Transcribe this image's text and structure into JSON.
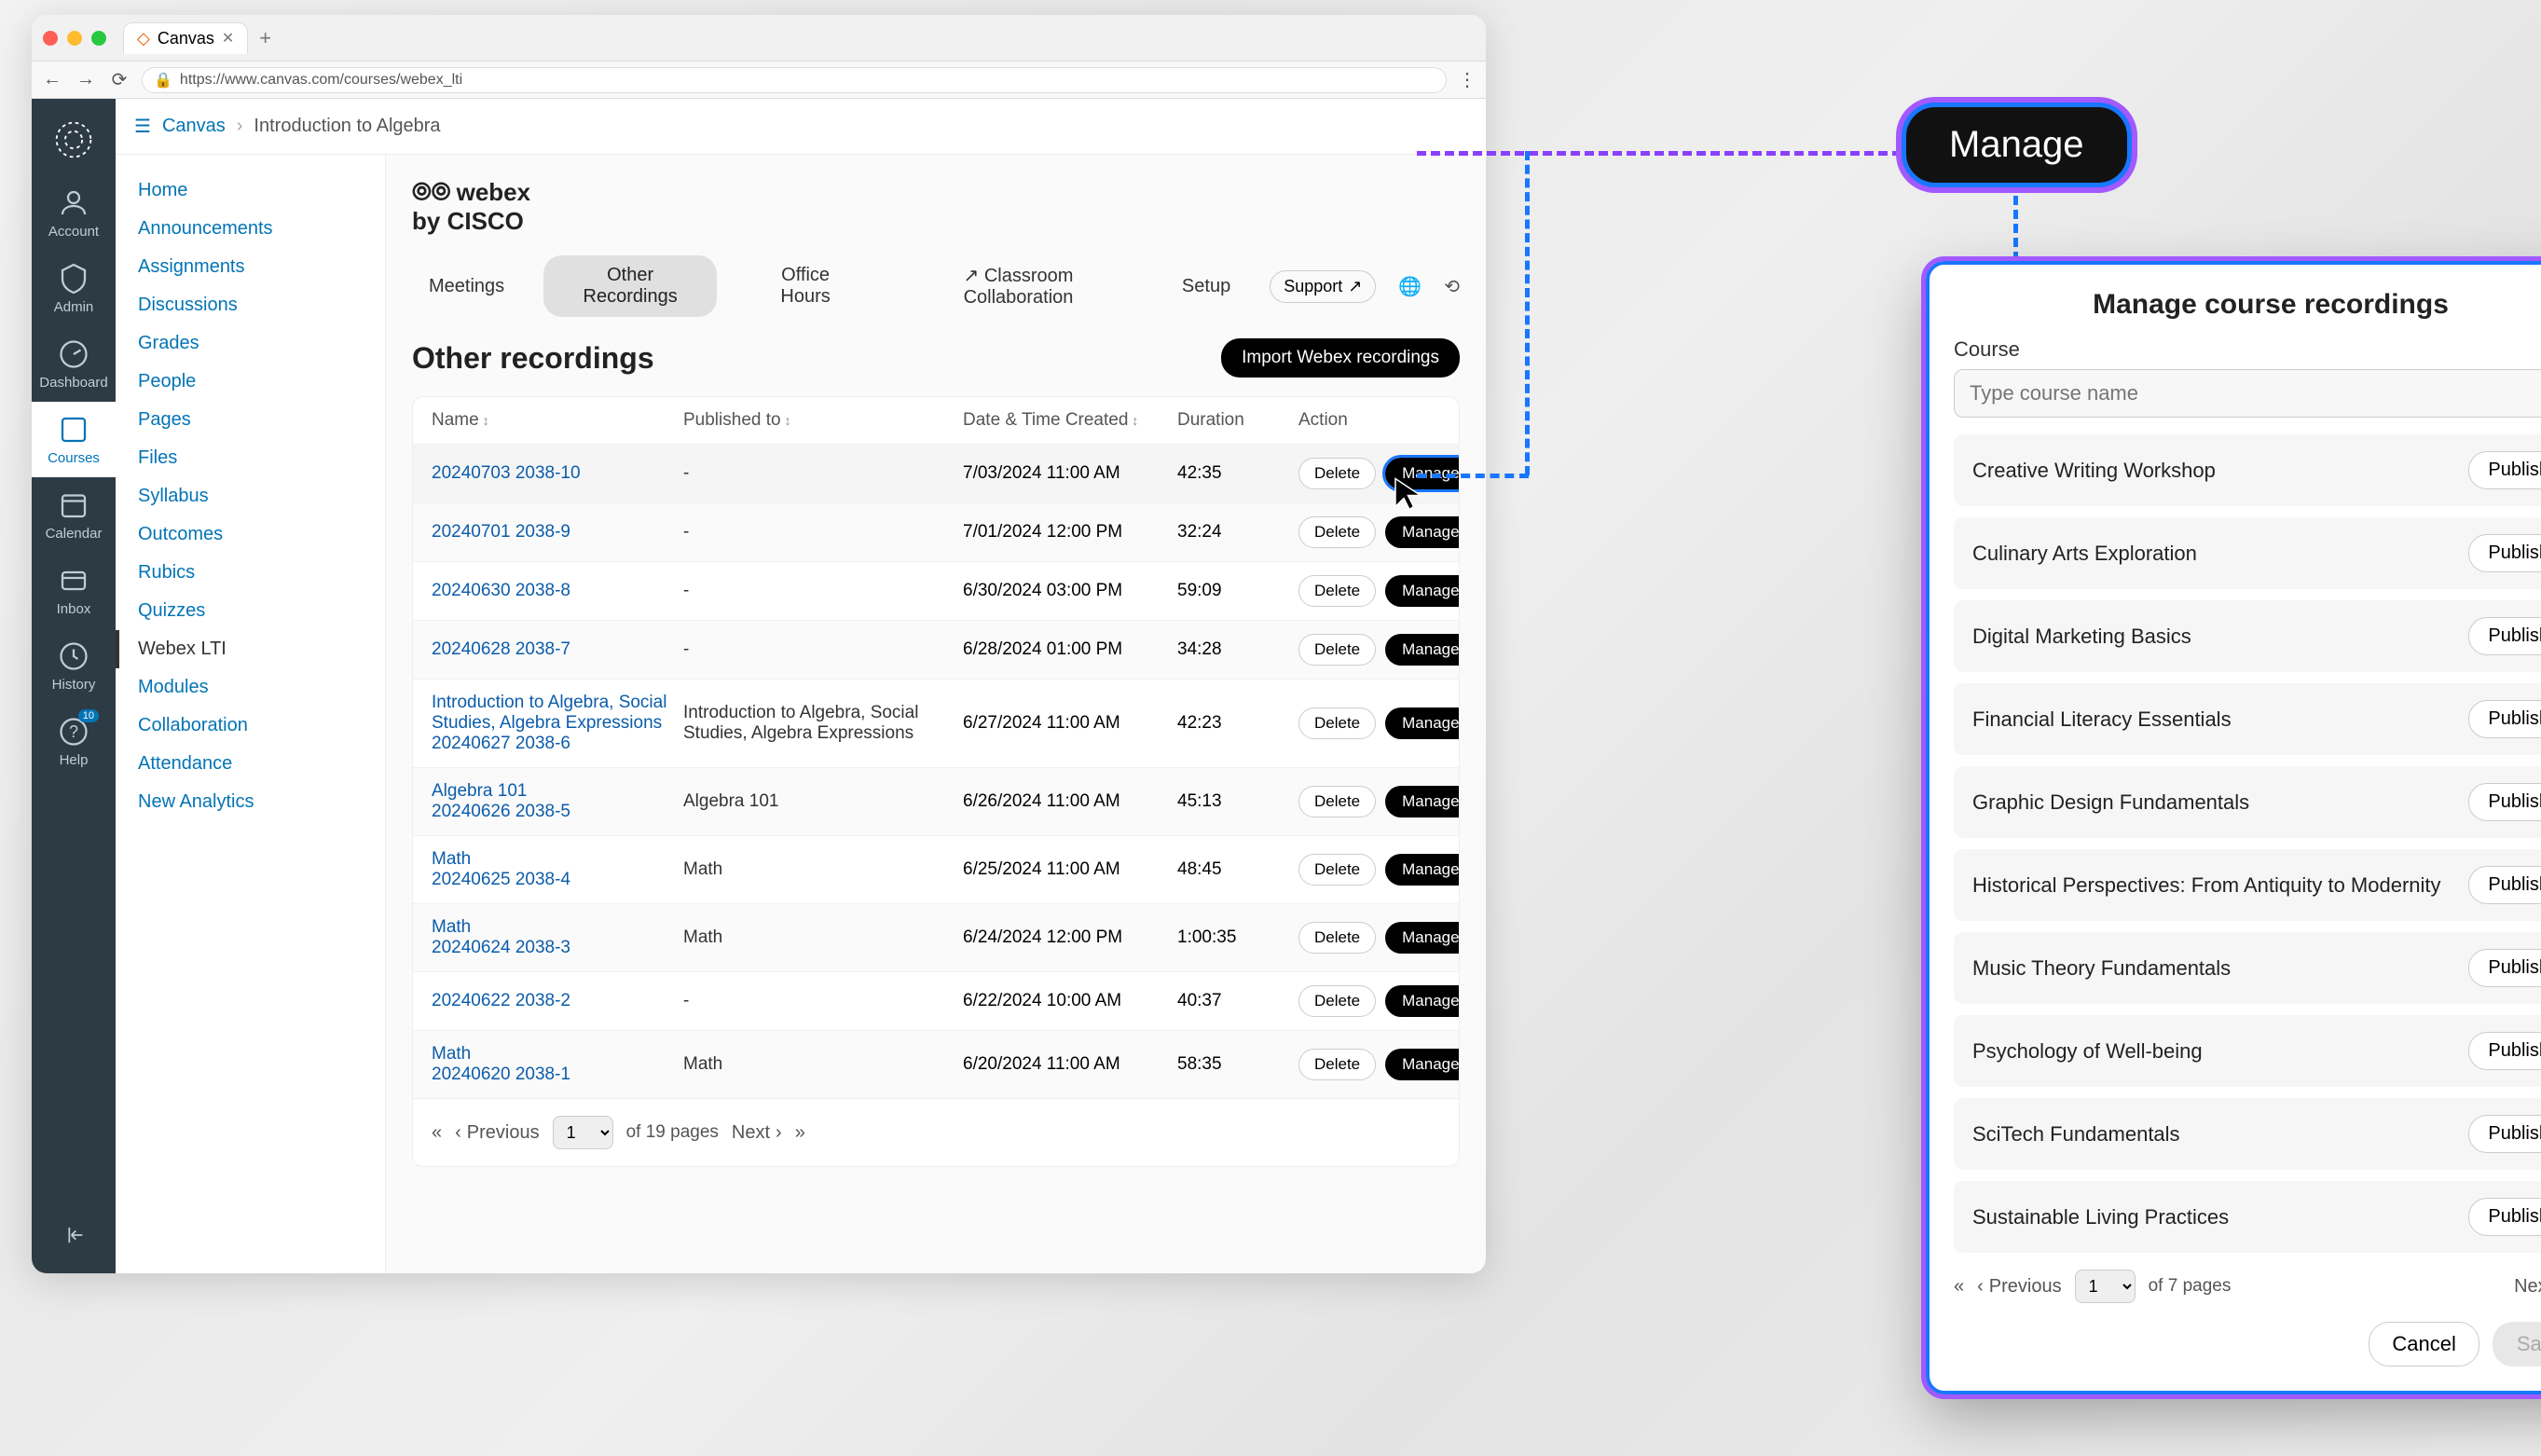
{
  "browser": {
    "tab_title": "Canvas",
    "url": "https://www.canvas.com/courses/webex_lti"
  },
  "rail": {
    "items": [
      {
        "label": "Account"
      },
      {
        "label": "Admin"
      },
      {
        "label": "Dashboard"
      },
      {
        "label": "Courses",
        "active": true
      },
      {
        "label": "Calendar"
      },
      {
        "label": "Inbox"
      },
      {
        "label": "History"
      },
      {
        "label": "Help",
        "badge": "10"
      }
    ]
  },
  "breadcrumb": {
    "root": "Canvas",
    "page": "Introduction to Algebra"
  },
  "course_nav": [
    "Home",
    "Announcements",
    "Assignments",
    "Discussions",
    "Grades",
    "People",
    "Pages",
    "Files",
    "Syllabus",
    "Outcomes",
    "Rubics",
    "Quizzes",
    "Webex LTI",
    "Modules",
    "Collaboration",
    "Attendance",
    "New Analytics"
  ],
  "course_nav_active": "Webex LTI",
  "webex": {
    "brand": "webex",
    "brand_sub": "by CISCO",
    "tabs": [
      "Meetings",
      "Other Recordings",
      "Office Hours",
      "Classroom Collaboration",
      "Setup"
    ],
    "active_tab": "Other Recordings",
    "support": "Support",
    "section_title": "Other recordings",
    "import_btn": "Import Webex recordings",
    "columns": {
      "name": "Name",
      "published": "Published to",
      "datetime": "Date & Time Created",
      "duration": "Duration",
      "action": "Action"
    },
    "delete_label": "Delete",
    "manage_label": "Manage",
    "rows": [
      {
        "name": "20240703 2038-10",
        "published": "-",
        "datetime": "7/03/2024 11:00 AM",
        "duration": "42:35",
        "highlighted": true
      },
      {
        "name": "20240701 2038-9",
        "published": "-",
        "datetime": "7/01/2024 12:00 PM",
        "duration": "32:24"
      },
      {
        "name": "20240630 2038-8",
        "published": "-",
        "datetime": "6/30/2024 03:00 PM",
        "duration": "59:09"
      },
      {
        "name": "20240628 2038-7",
        "published": "-",
        "datetime": "6/28/2024 01:00 PM",
        "duration": "34:28"
      },
      {
        "name": "Introduction to Algebra, Social Studies, Algebra Expressions\n20240627 2038-6",
        "published": "Introduction to Algebra, Social Studies, Algebra Expressions",
        "datetime": "6/27/2024 11:00 AM",
        "duration": "42:23"
      },
      {
        "name": "Algebra 101\n20240626 2038-5",
        "published": "Algebra 101",
        "datetime": "6/26/2024 11:00 AM",
        "duration": "45:13"
      },
      {
        "name": "Math\n20240625 2038-4",
        "published": "Math",
        "datetime": "6/25/2024 11:00 AM",
        "duration": "48:45"
      },
      {
        "name": "Math\n20240624 2038-3",
        "published": "Math",
        "datetime": "6/24/2024 12:00 PM",
        "duration": "1:00:35"
      },
      {
        "name": "20240622 2038-2",
        "published": "-",
        "datetime": "6/22/2024 10:00 AM",
        "duration": "40:37"
      },
      {
        "name": "Math\n20240620 2038-1",
        "published": "Math",
        "datetime": "6/20/2024 11:00 AM",
        "duration": "58:35"
      }
    ],
    "pager": {
      "prev": "Previous",
      "next": "Next",
      "page": "1",
      "total": "of 19 pages"
    }
  },
  "callout": {
    "label": "Manage"
  },
  "modal": {
    "title": "Manage course recordings",
    "course_label": "Course",
    "placeholder": "Type course name",
    "publish_label": "Publish",
    "courses": [
      "Creative Writing Workshop",
      "Culinary Arts Exploration",
      "Digital Marketing Basics",
      "Financial Literacy Essentials",
      "Graphic Design Fundamentals",
      "Historical Perspectives: From Antiquity to Modernity",
      "Music Theory Fundamentals",
      "Psychology of Well-being",
      "SciTech Fundamentals",
      "Sustainable Living Practices"
    ],
    "pager": {
      "prev": "Previous",
      "next": "Next",
      "page": "1",
      "total": "of 7 pages"
    },
    "cancel": "Cancel",
    "save": "Save"
  }
}
